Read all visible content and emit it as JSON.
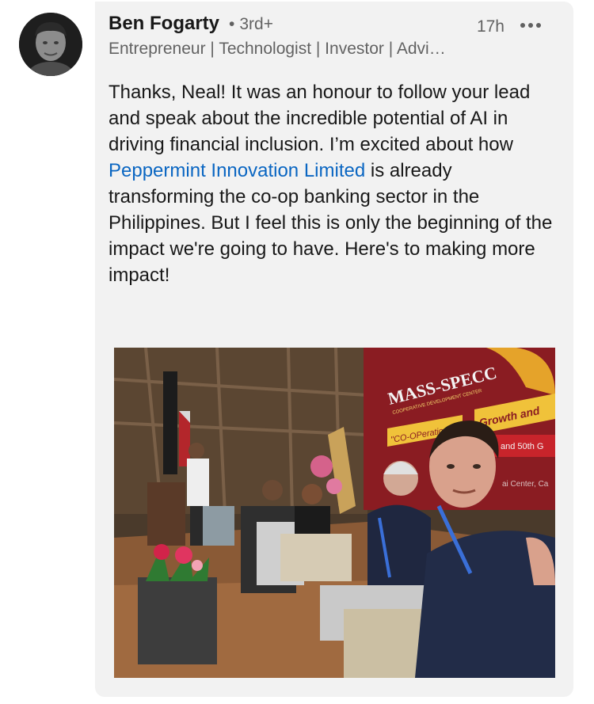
{
  "author": {
    "name": "Ben Fogarty",
    "separator": "•",
    "degree": "3rd+",
    "headline": "Entrepreneur | Technologist | Investor | Advi…",
    "timestamp": "17h"
  },
  "comment": {
    "text_before": "Thanks, Neal! It was an honour to follow your lead and speak about the incredible potential of AI in driving financial inclusion. I’m excited about how ",
    "link_text": "Peppermint Innovation Limited",
    "text_after": " is already transforming the co-op banking sector in the Philippines. But I feel this is only the beginning of the impact we're going to have.  Here's to making more impact!"
  },
  "photo": {
    "sign_brand": "MASS-SPECC",
    "sign_subtitle": "COOPERATIVE DEVELOPMENT CENTER",
    "banner_text_1": "Growth and",
    "banner_text_2": "\"CO-OPeratio",
    "banner_text_3": "and 50th G",
    "banner_text_4": "ai Center, Ca"
  },
  "colors": {
    "link": "#0a66c2",
    "bubble": "#f2f2f2",
    "text_primary": "rgba(0,0,0,0.9)",
    "text_secondary": "rgba(0,0,0,0.6)"
  },
  "icons": {
    "more": "ellipsis-horizontal-icon"
  }
}
